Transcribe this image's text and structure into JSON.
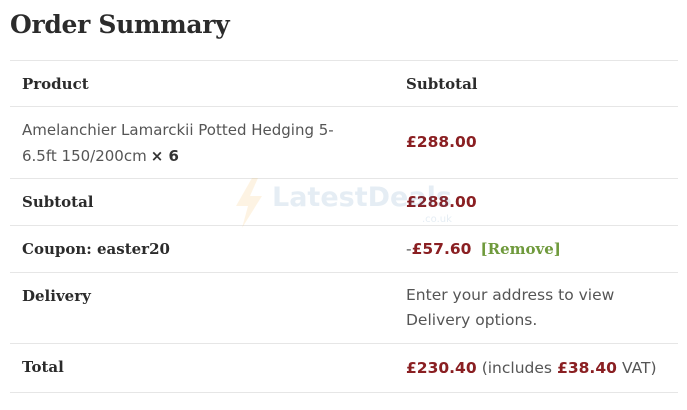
{
  "title": "Order Summary",
  "table": {
    "headers": {
      "product": "Product",
      "subtotal": "Subtotal"
    },
    "item": {
      "name": "Amelanchier Lamarckii Potted Hedging 5-6.5ft 150/200cm",
      "qty": "× 6",
      "price": "£288.00"
    },
    "subtotal": {
      "label": "Subtotal",
      "value": "£288.00"
    },
    "coupon": {
      "label": "Coupon: easter20",
      "prefix": "-",
      "value": "£57.60",
      "remove": "[Remove]"
    },
    "delivery": {
      "label": "Delivery",
      "text": "Enter your address to view Delivery options."
    },
    "total": {
      "label": "Total",
      "value": "£230.40",
      "incl_open": "(includes",
      "vat_value": "£38.40",
      "incl_close": "VAT)"
    }
  },
  "watermark": {
    "text": "LatestDeals",
    "sub": ".co.uk"
  },
  "colors": {
    "price": "#8a1f22",
    "link": "#6f9a3c",
    "border": "#e6e6e6"
  }
}
